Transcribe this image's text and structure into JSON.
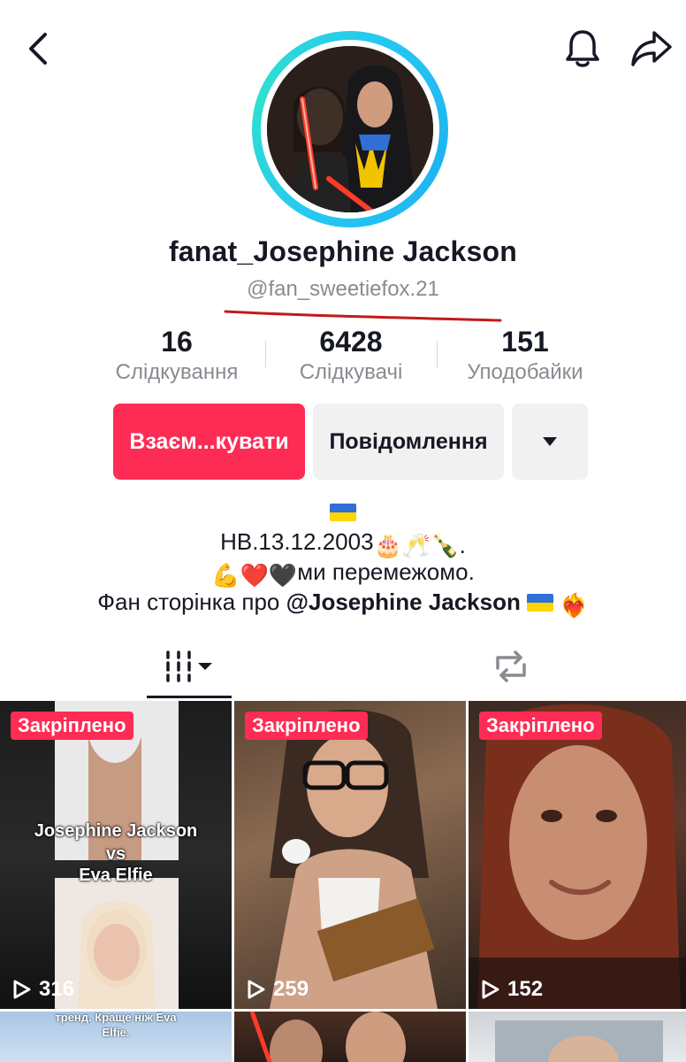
{
  "profile": {
    "display_name": "fanat_Josephine Jackson",
    "username": "@fan_sweetiefox.21"
  },
  "stats": [
    {
      "value": "16",
      "label": "Слідкування"
    },
    {
      "value": "6428",
      "label": "Слідкувачі"
    },
    {
      "value": "151",
      "label": "Уподобайки"
    }
  ],
  "buttons": {
    "follow_back": "Взаєм...кувати",
    "message": "Повідомлення"
  },
  "bio": {
    "line1": "НВ.13.12.2003",
    "line1_emoji": "🎂🥂🍾.",
    "line2_emoji": "💪❤️🖤",
    "line2": "ми перемежомо.",
    "line3_prefix": "Фан сторінка про ",
    "line3_mention": "@Josephine Jackson",
    "line3_emoji": "❤️‍🔥"
  },
  "videos": [
    {
      "pinned": "Закріплено",
      "views": "316",
      "overlay_1": "Josephine Jackson",
      "overlay_2": "vs",
      "overlay_3": "Eva Elfie"
    },
    {
      "pinned": "Закріплено",
      "views": "259"
    },
    {
      "pinned": "Закріплено",
      "views": "152"
    }
  ],
  "row2": {
    "caption_1": "тренд. Краще ніж Eva",
    "caption_2": "Elfie."
  },
  "colors": {
    "accent": "#fe2c55",
    "ring": "#25c7f2",
    "muted": "#8a8b91",
    "button_gray": "#f1f1f2"
  },
  "icons": [
    "back-arrow-icon",
    "bell-icon",
    "share-icon",
    "chevron-down-icon",
    "grid-icon",
    "repost-icon",
    "play-icon",
    "ukraine-flag-icon"
  ]
}
